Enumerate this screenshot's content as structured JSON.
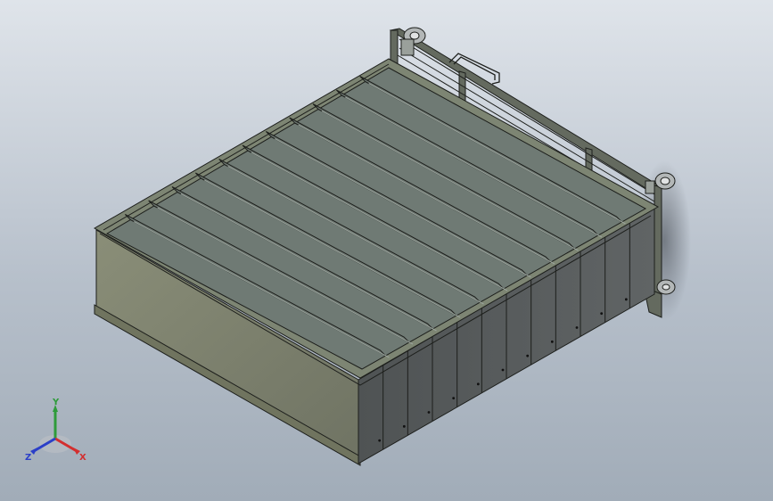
{
  "viewport": {
    "background_top": "#dfe4ea",
    "background_bottom": "#a1acb8"
  },
  "model": {
    "partition_count": 11,
    "front_panel_count": 12,
    "wheel_count": 3,
    "colors": {
      "frame": "#5e6359",
      "edge": "#1d1f1c",
      "side_face": "#7b7f6c",
      "top_face": "#8d9689",
      "partition": "#707a74",
      "front_panel": "#55595a"
    }
  },
  "triad": {
    "x_label": "X",
    "y_label": "Y",
    "z_label": "Z",
    "x_color": "#d32f2f",
    "y_color": "#2e9b3a",
    "z_color": "#2b3fc8"
  }
}
